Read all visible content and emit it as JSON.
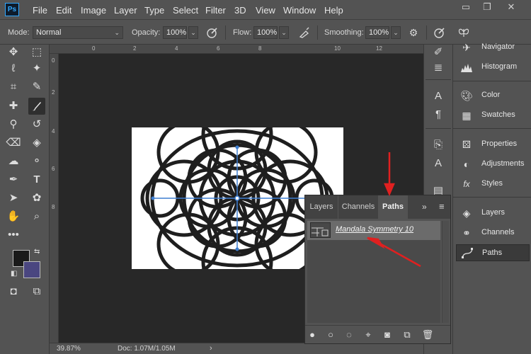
{
  "app": {
    "logo": "Ps"
  },
  "menu": [
    "File",
    "Edit",
    "Image",
    "Layer",
    "Type",
    "Select",
    "Filter",
    "3D",
    "View",
    "Window",
    "Help"
  ],
  "window_controls": {
    "minimize": "▭",
    "restore": "❐",
    "close": "✕"
  },
  "options": {
    "mode_label": "Mode:",
    "mode_value": "Normal",
    "opacity_label": "Opacity:",
    "opacity_value": "100%",
    "flow_label": "Flow:",
    "flow_value": "100%",
    "smoothing_label": "Smoothing:",
    "smoothing_value": "100%"
  },
  "rulers": {
    "top": [
      "0",
      "2",
      "4",
      "6",
      "8",
      "10",
      "12"
    ],
    "left": [
      "0",
      "2",
      "4",
      "6",
      "8"
    ]
  },
  "status": {
    "zoom": "39.87%",
    "doc": "Doc: 1.07M/1.05M",
    "arrow": "›"
  },
  "panels": {
    "right": [
      {
        "label": "Navigator",
        "icon": "navigator-icon"
      },
      {
        "label": "Histogram",
        "icon": "histogram-icon"
      },
      {
        "label": "Color",
        "icon": "color-palette-icon"
      },
      {
        "label": "Swatches",
        "icon": "swatches-icon"
      },
      {
        "label": "Properties",
        "icon": "properties-icon"
      },
      {
        "label": "Adjustments",
        "icon": "adjustments-icon"
      },
      {
        "label": "Styles",
        "icon": "styles-icon"
      },
      {
        "label": "Layers",
        "icon": "layers-icon"
      },
      {
        "label": "Channels",
        "icon": "channels-icon"
      },
      {
        "label": "Paths",
        "icon": "paths-icon",
        "selected": true
      }
    ]
  },
  "paths_panel": {
    "tabs": [
      {
        "label": "Layers"
      },
      {
        "label": "Channels"
      },
      {
        "label": "Paths",
        "active": true
      }
    ],
    "collapse": "»",
    "menu": "≡",
    "items": [
      {
        "name": "Mandala Symmetry 10"
      }
    ]
  },
  "colors": {
    "ui": "#535353",
    "canvas": "#282828",
    "accent": "#31a8ff",
    "background_color_swatch": "#4a4680",
    "annotation_arrow": "#e02020"
  }
}
